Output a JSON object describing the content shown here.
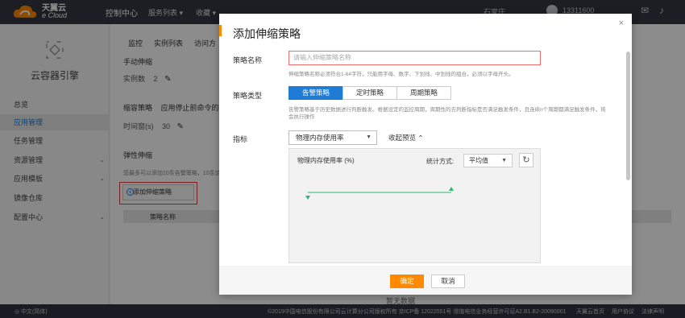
{
  "topbar": {
    "logo_cn": "天翼云",
    "logo_en": "e Cloud",
    "console": "控制中心",
    "services": "服务列表",
    "favorites": "收藏",
    "region": "石家庄",
    "user": "13311600"
  },
  "sidebar": {
    "title": "云容器引擎",
    "items": [
      {
        "label": "总览"
      },
      {
        "label": "应用管理"
      },
      {
        "label": "任务管理"
      },
      {
        "label": "资源管理"
      },
      {
        "label": "应用模板"
      },
      {
        "label": "镜像仓库"
      },
      {
        "label": "配置中心"
      }
    ]
  },
  "main": {
    "tabs": [
      "监控",
      "实例列表",
      "访问方"
    ],
    "manual_scale": {
      "title": "手动伸缩",
      "label": "实例数",
      "value": "2"
    },
    "shrink": {
      "title": "缩容策略",
      "desc": "应用停止前命令的影",
      "label": "时间窗(s)",
      "value": "30"
    },
    "elastic": {
      "title": "弹性伸缩",
      "desc": "您最多可以添加10条告警策略，10条定"
    },
    "add_button": "添加伸缩策略",
    "table_header": "策略名称",
    "no_data": "暂无数据"
  },
  "modal": {
    "title": "添加伸缩策略",
    "name_label": "策略名称",
    "name_placeholder": "请输入伸缩策略名称",
    "name_hint": "伸缩策略名称必须符合1-64字符，只能用字母、数字、下划线、中划线的组合，必须以字母开头。",
    "type_label": "策略类型",
    "types": [
      "告警策略",
      "定时策略",
      "周期策略"
    ],
    "type_hint": "告警策略基于历史数据进行判断触发。根据设定的监控周期，周期性的去判断指标是否满足触发条件，且连续n个周期都满足触发条件，将会执行操作",
    "metric_label": "指标",
    "metric_value": "物理内存使用率",
    "collapse": "收起预览",
    "chart_title": "物理内存使用率 (%)",
    "stat_label": "统计方式:",
    "stat_value": "平均值",
    "ok": "确定",
    "cancel": "取消"
  },
  "footer": {
    "lang": "中文(简体)",
    "copyright": "©2019中国电信股份有限公司云计算分公司版权所有  京ICP备 12022551号  增值电信业务经营许可证A2.B1.B2-20090001",
    "links": [
      "天翼云首页",
      "用户协议",
      "法律声明"
    ]
  },
  "colors": {
    "accent_orange": "#ff8a00",
    "primary_blue": "#1e7bd6",
    "chart_green": "#2eb872",
    "error_red": "#e03a3a"
  }
}
